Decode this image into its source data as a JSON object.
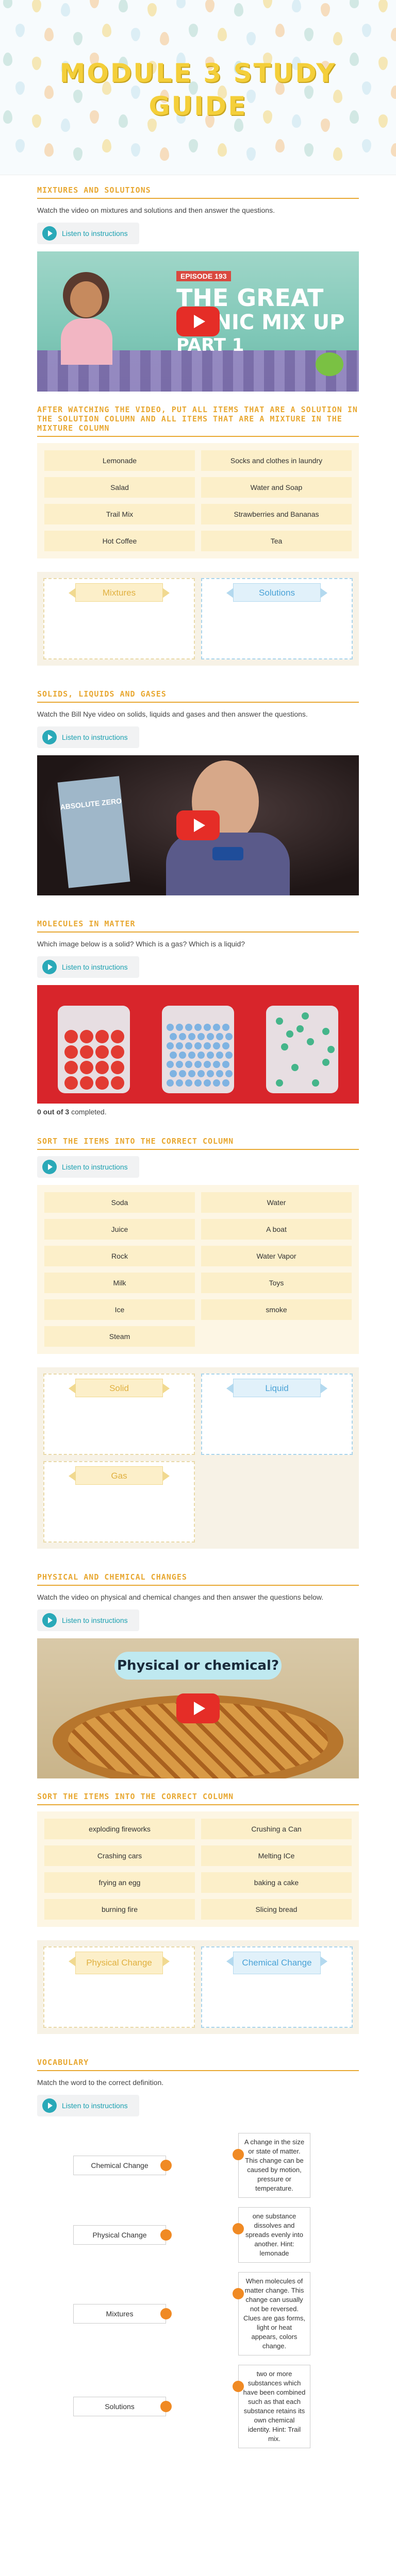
{
  "header": {
    "title_line1": "MODULE 3 STUDY",
    "title_line2": "GUIDE"
  },
  "sections": {
    "mixtures": {
      "title": "MIXTURES AND SOLUTIONS",
      "desc": "Watch the video on mixtures and solutions and then answer the questions.",
      "listen": "Listen to instructions",
      "video_episode": "EPISODE 193",
      "video_title_1": "THE GREAT",
      "video_title_2": "PICNIC MIX UP",
      "video_title_3": "PART 1"
    },
    "sort1": {
      "title": "AFTER WATCHING THE VIDEO, PUT ALL ITEMS THAT ARE A SOLUTION IN THE SOLUTION COLUMN AND ALL ITEMS THAT ARE A MIXTURE IN THE MIXTURE COLUMN",
      "items": [
        "Lemonade",
        "Socks and clothes in laundry",
        "Salad",
        "Water and Soap",
        "Trail Mix",
        "Strawberries and Bananas",
        "Hot Coffee",
        "Tea"
      ],
      "zone_left": "Mixtures",
      "zone_right": "Solutions"
    },
    "states": {
      "title": "SOLIDS, LIQUIDS AND GASES",
      "desc": "Watch the Bill Nye video on solids, liquids and gases and then answer the questions.",
      "listen": "Listen to instructions",
      "book_text": "ABSOLUTE ZERO"
    },
    "molecules": {
      "title": "MOLECULES IN MATTER",
      "desc": "Which image below is a solid? Which is a gas? Which is a liquid?",
      "listen": "Listen to instructions",
      "progress_count": "0 out of 3",
      "progress_suffix": " completed."
    },
    "sort2": {
      "title": "SORT THE ITEMS INTO THE CORRECT COLUMN",
      "listen": "Listen to instructions",
      "items": [
        "Soda",
        "Water",
        "Juice",
        "A boat",
        "Rock",
        "Water Vapor",
        "Milk",
        "Toys",
        "Ice",
        "smoke",
        "Steam"
      ],
      "zone_solid": "Solid",
      "zone_liquid": "Liquid",
      "zone_gas": "Gas"
    },
    "changes": {
      "title": "PHYSICAL AND CHEMICAL CHANGES",
      "desc": "Watch the video on physical and chemical changes and then answer the questions below.",
      "listen": "Listen to instructions",
      "video_caption": "Physical or chemical?"
    },
    "sort3": {
      "title": "SORT THE ITEMS INTO THE CORRECT COLUMN",
      "items": [
        "exploding fireworks",
        "Crushing a Can",
        "Crashing cars",
        "Melting ICe",
        "frying an egg",
        "baking a cake",
        "burning fire",
        "Slicing bread"
      ],
      "zone_left": "Physical Change",
      "zone_right": "Chemical Change"
    },
    "vocab": {
      "title": "VOCABULARY",
      "desc": "Match the word to the correct definition.",
      "listen": "Listen to instructions",
      "terms": [
        "Chemical Change",
        "Physical Change",
        "Mixtures",
        "Solutions"
      ],
      "definitions": [
        "A change in the size or state of matter. This change can be caused by motion, pressure or temperature.",
        "one substance dissolves and spreads evenly into another. Hint: lemonade",
        "When molecules of matter change. This change can usually not be reversed. Clues are gas forms, light or heat appears, colors change.",
        "two or more substances which have been combined such as that each substance retains its own chemical identity. Hint: Trail mix."
      ]
    }
  },
  "colors": {
    "accent": "#e8a832",
    "teal": "#2aa9b8",
    "youtube": "#e52d27",
    "orange_dot": "#f08a24"
  }
}
